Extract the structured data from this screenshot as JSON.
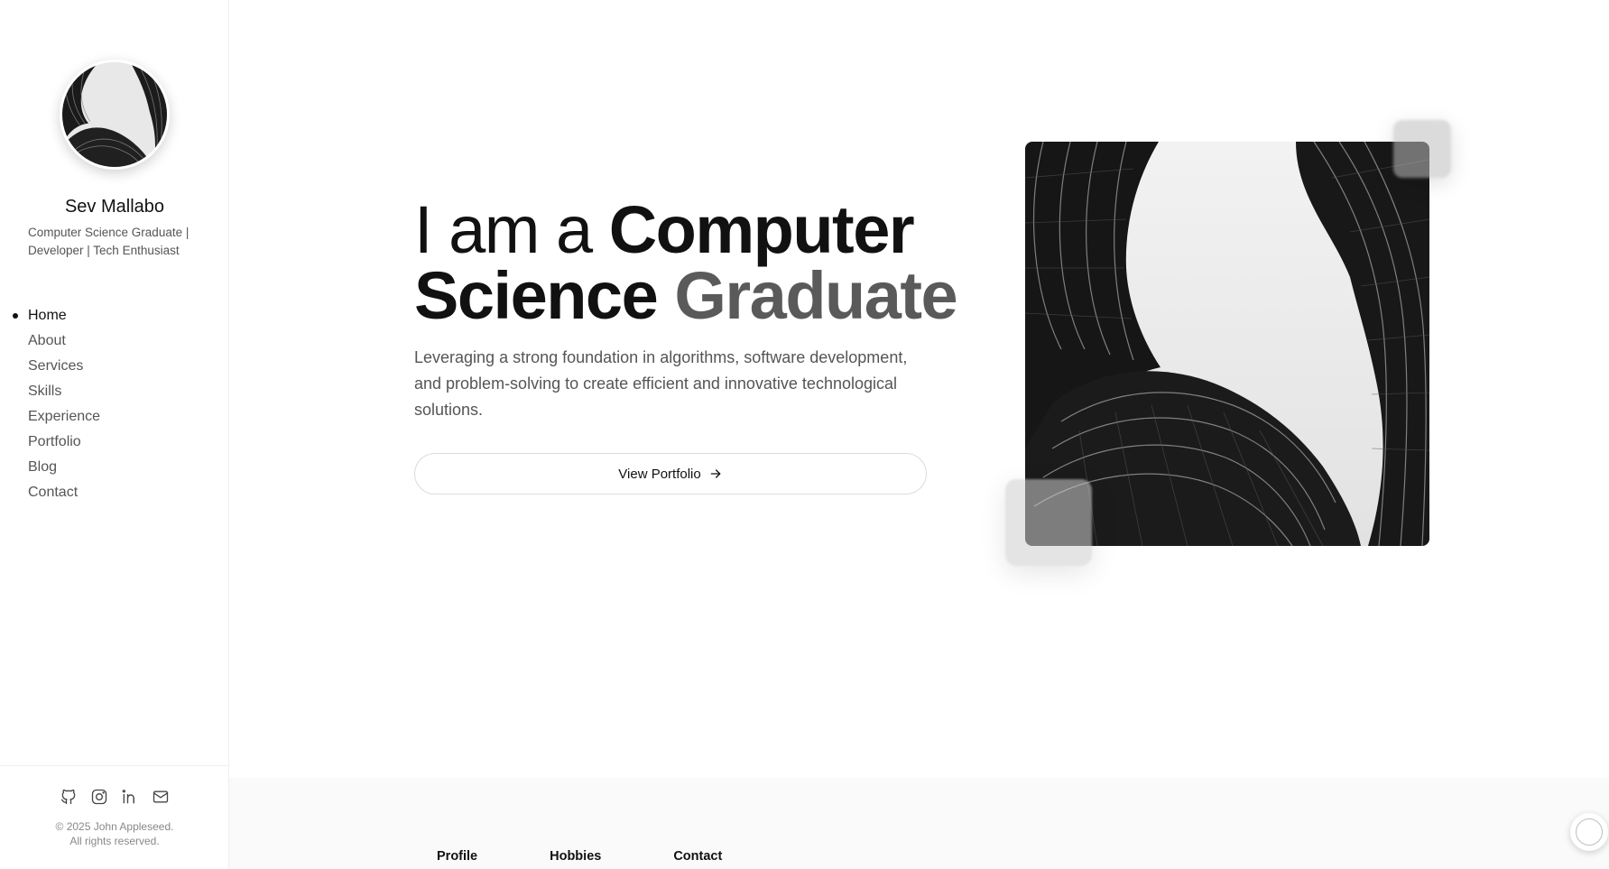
{
  "sidebar": {
    "avatar_alt": "avatar",
    "name": "Sev Mallabo",
    "tagline": "Computer Science Graduate | Developer | Tech Enthusiast",
    "nav": [
      {
        "label": "Home",
        "active": true
      },
      {
        "label": "About",
        "active": false
      },
      {
        "label": "Services",
        "active": false
      },
      {
        "label": "Skills",
        "active": false
      },
      {
        "label": "Experience",
        "active": false
      },
      {
        "label": "Portfolio",
        "active": false
      },
      {
        "label": "Blog",
        "active": false
      },
      {
        "label": "Contact",
        "active": false
      }
    ],
    "social_icons": [
      "github-icon",
      "instagram-icon",
      "linkedin-icon",
      "mail-icon"
    ],
    "copyright_line1": "© 2025 John Appleseed.",
    "copyright_line2": "All rights reserved."
  },
  "hero": {
    "title_part1": "I am a ",
    "title_part2": "Computer",
    "title_part3": "Science ",
    "title_part4": "Graduate",
    "description": "Leveraging a strong foundation in algorithms, software development, and problem-solving to create efficient and innovative technological solutions.",
    "cta_label": "View Portfolio",
    "cta_icon": "arrow-right-icon"
  },
  "bottom_tabs": [
    "Profile",
    "Hobbies",
    "Contact"
  ],
  "colors": {
    "text_primary": "#111111",
    "text_secondary": "#555555",
    "accent_grey": "#5a5a5a",
    "border": "#dcdcdc"
  }
}
